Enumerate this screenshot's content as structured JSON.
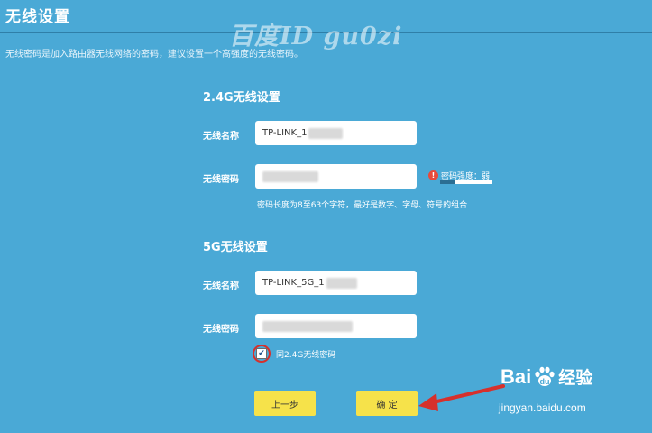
{
  "page": {
    "title": "无线设置",
    "intro": "无线密码是加入路由器无线网络的密码，建议设置一个高强度的无线密码。"
  },
  "watermark": "百度ID gu0zi",
  "band_24g": {
    "heading": "2.4G无线设置",
    "name_label": "无线名称",
    "name_value": "TP-LINK_1",
    "password_label": "无线密码",
    "strength_text": "密码强度：弱",
    "strength_level": 0.3,
    "hint": "密码长度为8至63个字符，最好是数字、字母、符号的组合"
  },
  "band_5g": {
    "heading": "5G无线设置",
    "name_label": "无线名称",
    "name_value": "TP-LINK_5G_1",
    "password_label": "无线密码",
    "same_password_label": "同2.4G无线密码",
    "same_password_checked": true
  },
  "buttons": {
    "prev": "上一步",
    "confirm": "确 定"
  },
  "branding": {
    "logo_text": "Bai",
    "logo_text2": "经验",
    "url": "jingyan.baidu.com"
  },
  "colors": {
    "background": "#4aa9d6",
    "button": "#f6e24a",
    "warning": "#e84a3c",
    "annotation": "#d6302c"
  }
}
